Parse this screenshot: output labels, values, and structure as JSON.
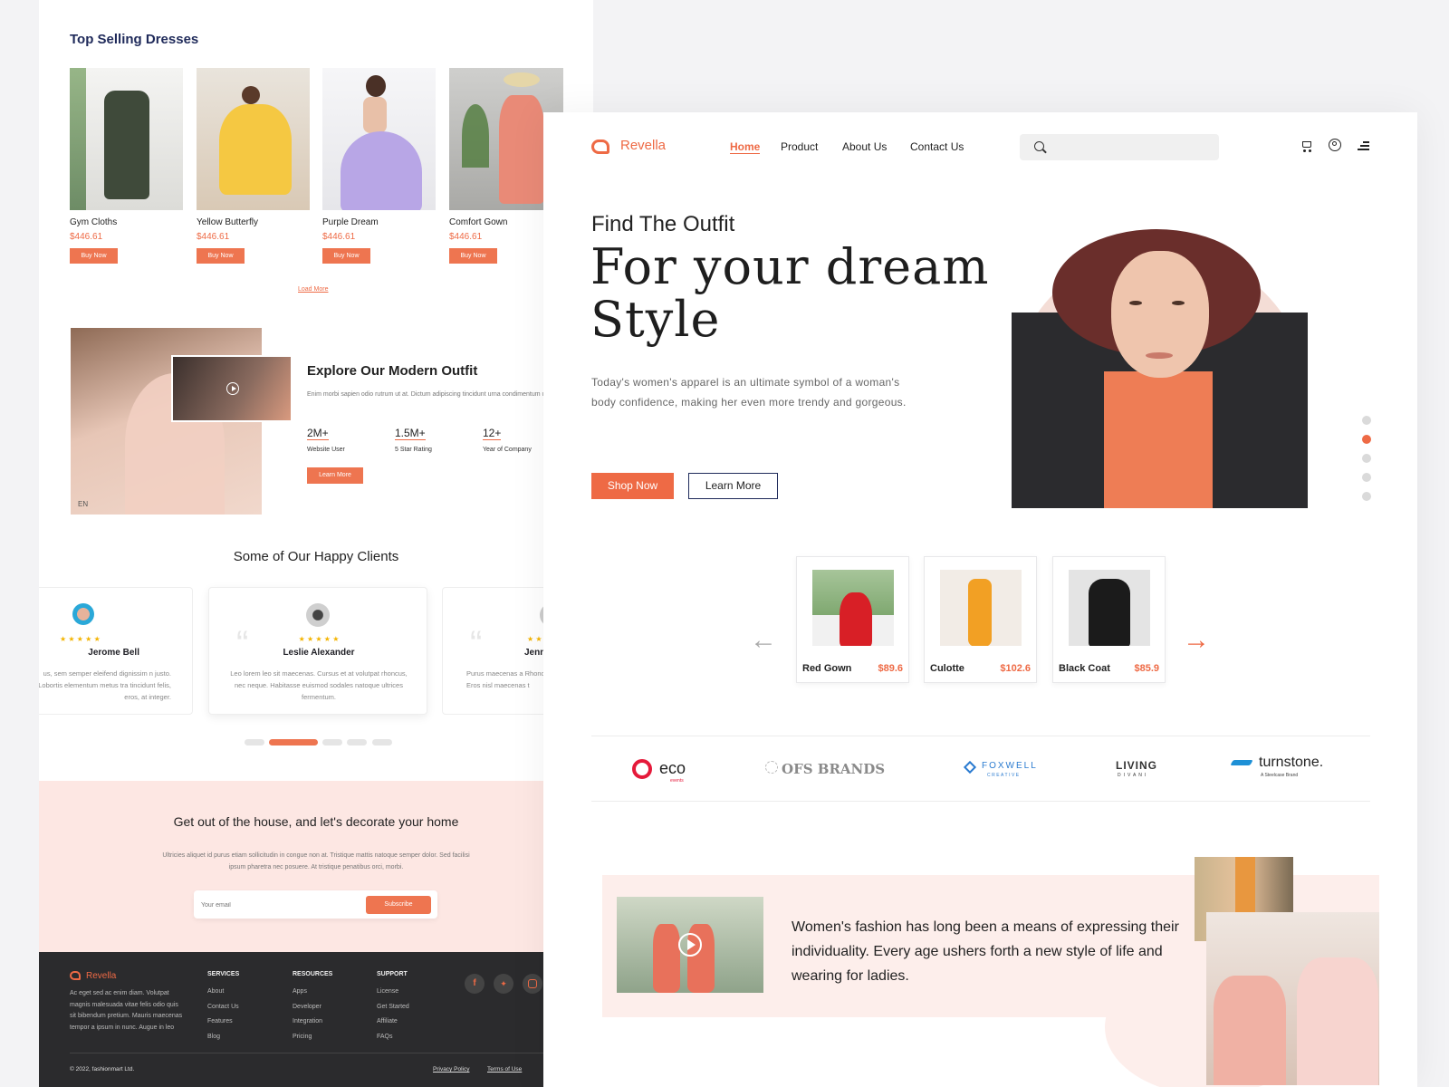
{
  "left": {
    "top_selling_title": "Top Selling Dresses",
    "products": [
      {
        "name": "Gym Cloths",
        "price": "$446.61",
        "button": "Buy Now"
      },
      {
        "name": "Yellow Butterfly",
        "price": "$446.61",
        "button": "Buy Now"
      },
      {
        "name": "Purple Dream",
        "price": "$446.61",
        "button": "Buy Now"
      },
      {
        "name": "Comfort Gown",
        "price": "$446.61",
        "button": "Buy Now"
      }
    ],
    "load_more": "Load More",
    "explore": {
      "title": "Explore Our Modern Outfit",
      "text": "Enim morbi sapien odio rutrum ut at. Dictum adipiscing tincidunt urna condimentum urna, ultricies posuere. Condimentum gravida sapien maecenas nunc.",
      "stats": [
        {
          "value": "2M+",
          "label": "Website User"
        },
        {
          "value": "1.5M+",
          "label": "5 Star Rating"
        },
        {
          "value": "12+",
          "label": "Year of Company"
        }
      ],
      "button": "Learn More",
      "image_text": "EN"
    },
    "clients": {
      "title": "Some of Our Happy Clients",
      "stars": "★ ★ ★ ★ ★",
      "items": [
        {
          "name": "Jerome Bell",
          "text": "us, sem semper eleifend dignissim n justo. Lobortis elementum metus tra tincidunt felis, eros, at integer."
        },
        {
          "name": "Leslie Alexander",
          "text": "Leo lorem leo sit maecenas. Cursus et at volutpat rhoncus, nec neque. Habitasse euismod sodales natoque ultrices fermentum."
        },
        {
          "name": "Jenn",
          "text": "Purus maecenas a Rhoncus, morbi am Eros nisl maecenas t"
        }
      ]
    },
    "newsletter": {
      "title": "Get out of the house, and let's decorate your home",
      "text": "Ultricies aliquet id purus etiam sollicitudin in congue non at. Tristique mattis natoque semper dolor. Sed facilisi ipsum pharetra nec posuere. At tristique penatibus orci, morbi.",
      "placeholder": "Your email",
      "button": "Subscribe"
    },
    "footer": {
      "brand": "Revella",
      "about": "Ac eget sed ac enim diam. Volutpat magnis malesuada vitae felis odio quis sit bibendum pretium. Mauris maecenas tempor a ipsum in nunc. Augue in leo",
      "columns": [
        {
          "title": "SERVICES",
          "links": [
            "About",
            "Contact Us",
            "Features",
            "Blog"
          ]
        },
        {
          "title": "RESOURCES",
          "links": [
            "Apps",
            "Developer",
            "Integration",
            "Pricing"
          ]
        },
        {
          "title": "SUPPORT",
          "links": [
            "License",
            "Get Started",
            "Affiliate",
            "FAQs"
          ]
        }
      ],
      "copyright": "© 2022, fashionmart Ltd.",
      "privacy": "Privacy Policy",
      "terms": "Terms of Use"
    }
  },
  "right": {
    "brand": "Revella",
    "nav": [
      "Home",
      "Product",
      "About Us",
      "Contact Us"
    ],
    "search_placeholder": "",
    "hero": {
      "kicker": "Find The Outfit",
      "title_line1": "For your dream",
      "title_line2": "Style",
      "text": "Today's women's apparel is an ultimate symbol of a woman's body confidence, making her even more trendy and gorgeous.",
      "primary_button": "Shop Now",
      "secondary_button": "Learn More"
    },
    "slider": {
      "slide_count": 5,
      "active_slide": 2
    },
    "products": [
      {
        "name": "Red Gown",
        "price": "$89.6"
      },
      {
        "name": "Culotte",
        "price": "$102.6"
      },
      {
        "name": "Black Coat",
        "price": "$85.9"
      }
    ],
    "brands": [
      {
        "name": "eco",
        "sub": "events"
      },
      {
        "name": "OFS BRANDS",
        "sub": ""
      },
      {
        "name": "FOXWELL",
        "sub": "CREATIVE"
      },
      {
        "name": "LIVING",
        "sub": "DIVANI"
      },
      {
        "name": "turnstone.",
        "sub": "A Steelcase Brand"
      }
    ],
    "story_text": "Women's fashion has long been a means of expressing their individuality. Every age ushers forth a new style of life and wearing for ladies."
  },
  "colors": {
    "accent": "#ee6a45",
    "navy": "#1f2a5a",
    "blush": "#fde7e3",
    "footer": "#2b2b2d"
  }
}
